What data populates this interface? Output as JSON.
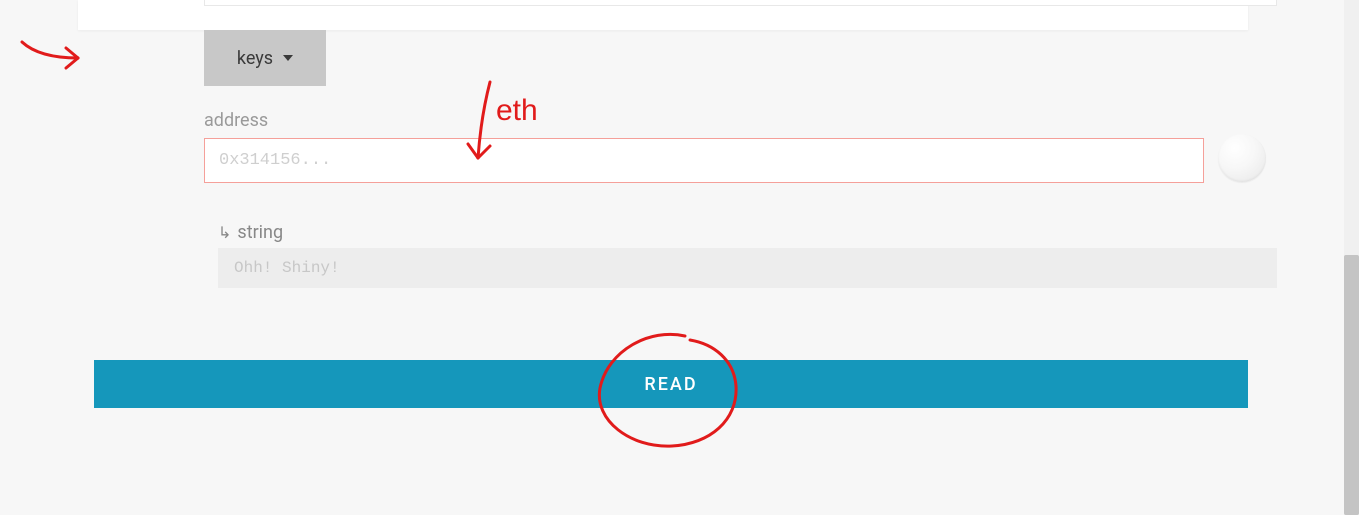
{
  "dropdown": {
    "label": "keys"
  },
  "address": {
    "label": "address",
    "placeholder": "0x314156...",
    "value": ""
  },
  "returnType": {
    "label": "string"
  },
  "output": {
    "placeholder": "Ohh! Shiny!"
  },
  "readButton": {
    "label": "READ"
  },
  "annotations": {
    "eth_label": "eth"
  },
  "colors": {
    "accent": "#1597bb",
    "error_border": "#f5a09a",
    "annotation": "#e11b1b"
  }
}
